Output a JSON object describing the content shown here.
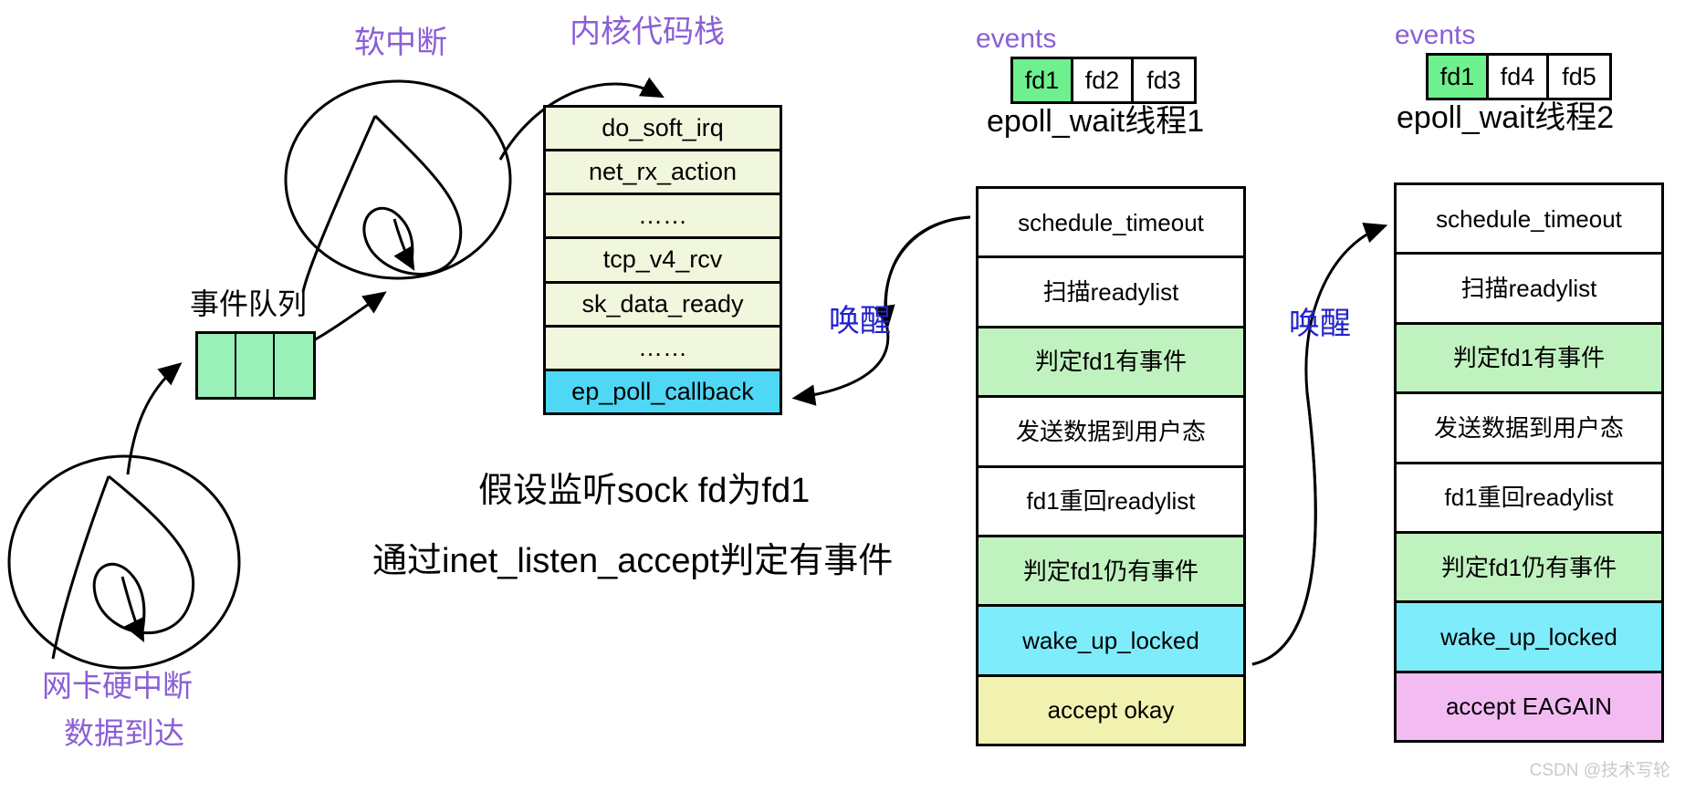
{
  "diagram": {
    "title_watermark": "CSDN @技术写轮",
    "labels": {
      "soft_irq": "软中断",
      "kernel_code_stack": "内核代码栈",
      "event_queue": "事件队列",
      "nic_hard_irq_line1": "网卡硬中断",
      "nic_hard_irq_line2": "数据到达",
      "wakeup_1": "唤醒",
      "wakeup_2": "唤醒",
      "note_line1": "假设监听sock fd为fd1",
      "note_line2": "通过inet_listen_accept判定有事件"
    },
    "kernel_stack": {
      "name": "内核代码栈",
      "rows": [
        {
          "text": "do_soft_irq",
          "bg": "#f0f7dc"
        },
        {
          "text": "net_rx_action",
          "bg": "#f0f7dc"
        },
        {
          "text": "……",
          "bg": "#f0f7dc"
        },
        {
          "text": "tcp_v4_rcv",
          "bg": "#f0f7dc"
        },
        {
          "text": "sk_data_ready",
          "bg": "#f0f7dc"
        },
        {
          "text": "……",
          "bg": "#f0f7dc"
        },
        {
          "text": "ep_poll_callback",
          "bg": "#4fd8f5"
        }
      ]
    },
    "threads": [
      {
        "events_label": "events",
        "events_cells": [
          {
            "text": "fd1",
            "bg": "#6ef08e"
          },
          {
            "text": "fd2",
            "bg": "#ffffff"
          },
          {
            "text": "fd3",
            "bg": "#ffffff"
          }
        ],
        "title": "epoll_wait线程1",
        "rows": [
          {
            "text": "schedule_timeout",
            "bg": "#ffffff"
          },
          {
            "text": "扫描readylist",
            "bg": "#ffffff"
          },
          {
            "text": "判定fd1有事件",
            "bg": "#c0f2bf"
          },
          {
            "text": "发送数据到用户态",
            "bg": "#ffffff"
          },
          {
            "text": "fd1重回readylist",
            "bg": "#ffffff"
          },
          {
            "text": "判定fd1仍有事件",
            "bg": "#c0f2bf"
          },
          {
            "text": "wake_up_locked",
            "bg": "#7eecfb"
          },
          {
            "text": "accept okay",
            "bg": "#f1f2b0"
          }
        ]
      },
      {
        "events_label": "events",
        "events_cells": [
          {
            "text": "fd1",
            "bg": "#6ef08e"
          },
          {
            "text": "fd4",
            "bg": "#ffffff"
          },
          {
            "text": "fd5",
            "bg": "#ffffff"
          }
        ],
        "title": "epoll_wait线程2",
        "rows": [
          {
            "text": "schedule_timeout",
            "bg": "#ffffff"
          },
          {
            "text": "扫描readylist",
            "bg": "#ffffff"
          },
          {
            "text": "判定fd1有事件",
            "bg": "#c0f2bf"
          },
          {
            "text": "发送数据到用户态",
            "bg": "#ffffff"
          },
          {
            "text": "fd1重回readylist",
            "bg": "#ffffff"
          },
          {
            "text": "判定fd1仍有事件",
            "bg": "#c0f2bf"
          },
          {
            "text": "wake_up_locked",
            "bg": "#7eecfb"
          },
          {
            "text": "accept EAGAIN",
            "bg": "#f2bcf2"
          }
        ]
      }
    ],
    "colors": {
      "purple_label": "#8a5fd6",
      "blue_label": "#2222cc",
      "stroke": "#000000",
      "kernel_row_bg": "#f0f7dc",
      "ep_poll_bg": "#4fd8f5",
      "event_queue_bg": "#99f0b8",
      "green_row": "#c0f2bf",
      "cyan_row": "#7eecfb",
      "yellow_row": "#f1f2b0",
      "pink_row": "#f2bcf2"
    }
  }
}
